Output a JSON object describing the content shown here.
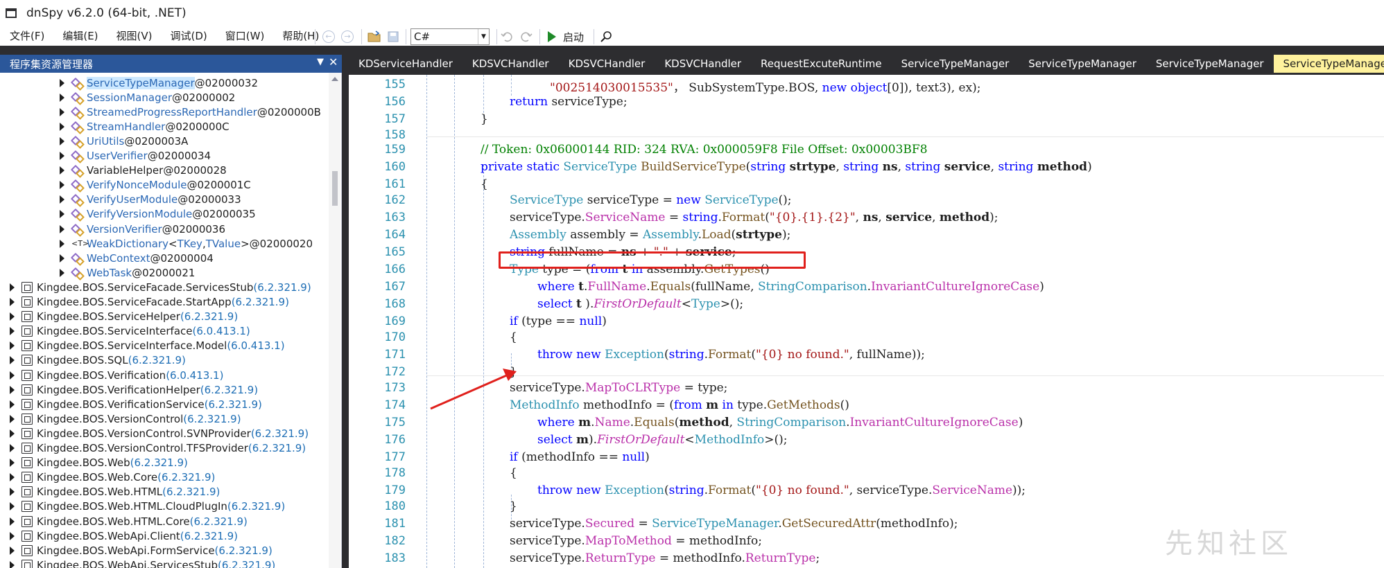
{
  "window": {
    "title": "dnSpy v6.2.0 (64-bit, .NET)"
  },
  "menu": {
    "items": [
      "文件(F)",
      "编辑(E)",
      "视图(V)",
      "调试(D)",
      "窗口(W)",
      "帮助(H)"
    ]
  },
  "toolbar": {
    "language": "C#",
    "run_label": "启动"
  },
  "explorer": {
    "title": "程序集资源管理器",
    "types": [
      {
        "name": "ServiceTypeManager",
        "token": "@02000032",
        "icon": "class-icon",
        "selected": true
      },
      {
        "name": "SessionManager",
        "token": "@02000002",
        "icon": "class-icon"
      },
      {
        "name": "StreamedProgressReportHandler",
        "token": "@0200000B",
        "icon": "class-icon"
      },
      {
        "name": "StreamHandler",
        "token": "@0200000C",
        "icon": "class-icon"
      },
      {
        "name": "UriUtils",
        "token": "@0200003A",
        "icon": "static-class-icon"
      },
      {
        "name": "UserVerifier",
        "token": "@02000034",
        "icon": "class-icon"
      },
      {
        "name": "VariableHelper",
        "token": "@02000028",
        "icon": "static-class-icon"
      },
      {
        "name": "VerifyNonceModule",
        "token": "@0200001C",
        "icon": "class-icon"
      },
      {
        "name": "VerifyUserModule",
        "token": "@02000033",
        "icon": "class-icon"
      },
      {
        "name": "VerifyVersionModule",
        "token": "@02000035",
        "icon": "class-icon"
      },
      {
        "name": "VersionVerifier",
        "token": "@02000036",
        "icon": "class-icon"
      },
      {
        "name": "WeakDictionary",
        "generic_open": "<",
        "generic_a": "TKey",
        "generic_sep": ", ",
        "generic_b": "TValue",
        "generic_close": ">",
        "token": "@02000020",
        "icon": "generic-class-icon"
      },
      {
        "name": "WebContext",
        "token": "@02000004",
        "icon": "class-icon"
      },
      {
        "name": "WebTask",
        "token": "@02000021",
        "icon": "class-icon"
      }
    ],
    "assemblies": [
      {
        "name": "Kingdee.BOS.ServiceFacade.ServicesStub",
        "version": "(6.2.321.9)"
      },
      {
        "name": "Kingdee.BOS.ServiceFacade.StartApp",
        "version": "(6.2.321.9)"
      },
      {
        "name": "Kingdee.BOS.ServiceHelper",
        "version": "(6.2.321.9)"
      },
      {
        "name": "Kingdee.BOS.ServiceInterface",
        "version": "(6.0.413.1)"
      },
      {
        "name": "Kingdee.BOS.ServiceInterface.Model",
        "version": "(6.0.413.1)"
      },
      {
        "name": "Kingdee.BOS.SQL",
        "version": "(6.2.321.9)"
      },
      {
        "name": "Kingdee.BOS.Verification",
        "version": "(6.0.413.1)"
      },
      {
        "name": "Kingdee.BOS.VerificationHelper",
        "version": "(6.2.321.9)"
      },
      {
        "name": "Kingdee.BOS.VerificationService",
        "version": "(6.2.321.9)"
      },
      {
        "name": "Kingdee.BOS.VersionControl",
        "version": "(6.2.321.9)"
      },
      {
        "name": "Kingdee.BOS.VersionControl.SVNProvider",
        "version": "(6.2.321.9)"
      },
      {
        "name": "Kingdee.BOS.VersionControl.TFSProvider",
        "version": "(6.2.321.9)"
      },
      {
        "name": "Kingdee.BOS.Web",
        "version": "(6.2.321.9)"
      },
      {
        "name": "Kingdee.BOS.Web.Core",
        "version": "(6.2.321.9)"
      },
      {
        "name": "Kingdee.BOS.Web.HTML",
        "version": "(6.2.321.9)"
      },
      {
        "name": "Kingdee.BOS.Web.HTML.CloudPlugIn",
        "version": "(6.2.321.9)"
      },
      {
        "name": "Kingdee.BOS.Web.HTML.Core",
        "version": "(6.2.321.9)"
      },
      {
        "name": "Kingdee.BOS.WebApi.Client",
        "version": "(6.2.321.9)"
      },
      {
        "name": "Kingdee.BOS.WebApi.FormService",
        "version": "(6.2.321.9)"
      },
      {
        "name": "Kingdee.BOS.WebApi.ServicesStub",
        "version": "(6.2.321.9)"
      }
    ]
  },
  "tabs": [
    {
      "label": "KDServiceHandler"
    },
    {
      "label": "KDSVCHandler"
    },
    {
      "label": "KDSVCHandler"
    },
    {
      "label": "KDSVCHandler"
    },
    {
      "label": "RequestExcuteRuntime"
    },
    {
      "label": "ServiceTypeManager"
    },
    {
      "label": "ServiceTypeManager"
    },
    {
      "label": "ServiceTypeManager"
    },
    {
      "label": "ServiceTypeManager",
      "active": true
    }
  ],
  "editor": {
    "lines": [
      {
        "n": "155",
        "tokens": [
          [
            "str",
            "\"002514030015535\""
          ],
          [
            "",
            "， SubSystemType.BOS, "
          ],
          [
            "kw",
            "new"
          ],
          [
            "",
            " "
          ],
          [
            "kw",
            "object"
          ],
          [
            "",
            "[0]), text3), ex);"
          ]
        ]
      },
      {
        "n": "156",
        "tokens": [
          [
            "kw",
            "return"
          ],
          [
            "",
            " serviceType;"
          ]
        ]
      },
      {
        "n": "157",
        "tokens": [
          [
            "",
            "}"
          ]
        ]
      },
      {
        "n": "158",
        "tokens": []
      },
      {
        "n": "159",
        "tokens": [
          [
            "cm",
            "// Token: 0x06000144 RID: 324 RVA: 0x000059F8 File Offset: 0x00003BF8"
          ]
        ]
      },
      {
        "n": "160",
        "tokens": [
          [
            "kw",
            "private static "
          ],
          [
            "ty",
            "ServiceType"
          ],
          [
            "",
            " "
          ],
          [
            "meth",
            "BuildServiceType"
          ],
          [
            "",
            "("
          ],
          [
            "kw",
            "string"
          ],
          [
            "",
            " "
          ],
          [
            "bold",
            "strtype"
          ],
          [
            "",
            ", "
          ],
          [
            "kw",
            "string"
          ],
          [
            "",
            " "
          ],
          [
            "bold",
            "ns"
          ],
          [
            "",
            ", "
          ],
          [
            "kw",
            "string"
          ],
          [
            "",
            " "
          ],
          [
            "bold",
            "service"
          ],
          [
            "",
            ", "
          ],
          [
            "kw",
            "string"
          ],
          [
            "",
            " "
          ],
          [
            "bold",
            "method"
          ],
          [
            "",
            ")"
          ]
        ]
      },
      {
        "n": "161",
        "tokens": [
          [
            "",
            "{"
          ]
        ]
      },
      {
        "n": "162",
        "tokens": [
          [
            "ty",
            "ServiceType"
          ],
          [
            "",
            " serviceType = "
          ],
          [
            "kw",
            "new"
          ],
          [
            "",
            " "
          ],
          [
            "ty",
            "ServiceType"
          ],
          [
            "",
            "();"
          ]
        ]
      },
      {
        "n": "163",
        "tokens": [
          [
            "",
            "serviceType."
          ],
          [
            "mem",
            "ServiceName"
          ],
          [
            "",
            " = "
          ],
          [
            "kw",
            "string"
          ],
          [
            "",
            "."
          ],
          [
            "meth",
            "Format"
          ],
          [
            "",
            "("
          ],
          [
            "str",
            "\"{0}.{1}.{2}\""
          ],
          [
            "",
            ", "
          ],
          [
            "bold",
            "ns"
          ],
          [
            "",
            ", "
          ],
          [
            "bold",
            "service"
          ],
          [
            "",
            ", "
          ],
          [
            "bold",
            "method"
          ],
          [
            "",
            ");"
          ]
        ]
      },
      {
        "n": "164",
        "tokens": [
          [
            "ty",
            "Assembly"
          ],
          [
            "",
            " assembly = "
          ],
          [
            "ty",
            "Assembly"
          ],
          [
            "",
            "."
          ],
          [
            "meth",
            "Load"
          ],
          [
            "",
            "("
          ],
          [
            "bold",
            "strtype"
          ],
          [
            "",
            ");"
          ]
        ]
      },
      {
        "n": "165",
        "tokens": [
          [
            "kw",
            "string"
          ],
          [
            "",
            " fullName = "
          ],
          [
            "bold",
            "ns"
          ],
          [
            "",
            " + "
          ],
          [
            "str",
            "\".\""
          ],
          [
            "",
            " + "
          ],
          [
            "bold",
            "service"
          ],
          [
            "",
            ";"
          ]
        ]
      },
      {
        "n": "166",
        "tokens": [
          [
            "ty",
            "Type"
          ],
          [
            "",
            " type = ("
          ],
          [
            "kw",
            "from"
          ],
          [
            "",
            " "
          ],
          [
            "bold",
            "t"
          ],
          [
            "",
            " "
          ],
          [
            "kw",
            "in"
          ],
          [
            "",
            " assembly."
          ],
          [
            "meth",
            "GetTypes"
          ],
          [
            "",
            "()"
          ]
        ]
      },
      {
        "n": "167",
        "tokens": [
          [
            "kw",
            "where"
          ],
          [
            "",
            " "
          ],
          [
            "bold",
            "t"
          ],
          [
            "",
            "."
          ],
          [
            "mem",
            "FullName"
          ],
          [
            "",
            "."
          ],
          [
            "meth",
            "Equals"
          ],
          [
            "",
            "(fullName, "
          ],
          [
            "ty",
            "StringComparison"
          ],
          [
            "",
            "."
          ],
          [
            "mem",
            "InvariantCultureIgnoreCase"
          ],
          [
            "",
            ")"
          ]
        ]
      },
      {
        "n": "168",
        "tokens": [
          [
            "kw",
            "select"
          ],
          [
            "",
            " "
          ],
          [
            "bold",
            "t"
          ],
          [
            "",
            " )."
          ],
          [
            "it",
            "FirstOrDefault"
          ],
          [
            "",
            "<"
          ],
          [
            "ty",
            "Type"
          ],
          [
            "",
            ">();"
          ]
        ]
      },
      {
        "n": "169",
        "tokens": [
          [
            "kw",
            "if"
          ],
          [
            "",
            " (type == "
          ],
          [
            "kw",
            "null"
          ],
          [
            "",
            ")"
          ]
        ]
      },
      {
        "n": "170",
        "tokens": [
          [
            "",
            "{"
          ]
        ]
      },
      {
        "n": "171",
        "tokens": [
          [
            "kw",
            "throw new "
          ],
          [
            "ty",
            "Exception"
          ],
          [
            "",
            "("
          ],
          [
            "kw",
            "string"
          ],
          [
            "",
            "."
          ],
          [
            "meth",
            "Format"
          ],
          [
            "",
            "("
          ],
          [
            "str",
            "\"{0} no found.\""
          ],
          [
            "",
            ", fullName));"
          ]
        ]
      },
      {
        "n": "172",
        "tokens": [
          [
            "",
            "}"
          ]
        ]
      },
      {
        "n": "173",
        "tokens": [
          [
            "",
            "serviceType."
          ],
          [
            "mem",
            "MapToCLRType"
          ],
          [
            "",
            " = type;"
          ]
        ]
      },
      {
        "n": "174",
        "tokens": [
          [
            "ty",
            "MethodInfo"
          ],
          [
            "",
            " methodInfo = ("
          ],
          [
            "kw",
            "from"
          ],
          [
            "",
            " "
          ],
          [
            "bold",
            "m"
          ],
          [
            "",
            " "
          ],
          [
            "kw",
            "in"
          ],
          [
            "",
            " type."
          ],
          [
            "meth",
            "GetMethods"
          ],
          [
            "",
            "()"
          ]
        ]
      },
      {
        "n": "175",
        "tokens": [
          [
            "kw",
            "where"
          ],
          [
            "",
            " "
          ],
          [
            "bold",
            "m"
          ],
          [
            "",
            "."
          ],
          [
            "mem",
            "Name"
          ],
          [
            "",
            "."
          ],
          [
            "meth",
            "Equals"
          ],
          [
            "",
            "("
          ],
          [
            "bold",
            "method"
          ],
          [
            "",
            ", "
          ],
          [
            "ty",
            "StringComparison"
          ],
          [
            "",
            "."
          ],
          [
            "mem",
            "InvariantCultureIgnoreCase"
          ],
          [
            "",
            ")"
          ]
        ]
      },
      {
        "n": "176",
        "tokens": [
          [
            "kw",
            "select"
          ],
          [
            "",
            " "
          ],
          [
            "bold",
            "m"
          ],
          [
            "",
            ")."
          ],
          [
            "it",
            "FirstOrDefault"
          ],
          [
            "",
            "<"
          ],
          [
            "ty",
            "MethodInfo"
          ],
          [
            "",
            ">();"
          ]
        ]
      },
      {
        "n": "177",
        "tokens": [
          [
            "kw",
            "if"
          ],
          [
            "",
            " (methodInfo == "
          ],
          [
            "kw",
            "null"
          ],
          [
            "",
            ")"
          ]
        ]
      },
      {
        "n": "178",
        "tokens": [
          [
            "",
            "{"
          ]
        ]
      },
      {
        "n": "179",
        "tokens": [
          [
            "kw",
            "throw new "
          ],
          [
            "ty",
            "Exception"
          ],
          [
            "",
            "("
          ],
          [
            "kw",
            "string"
          ],
          [
            "",
            "."
          ],
          [
            "meth",
            "Format"
          ],
          [
            "",
            "("
          ],
          [
            "str",
            "\"{0} no found.\""
          ],
          [
            "",
            ", serviceType."
          ],
          [
            "mem",
            "ServiceName"
          ],
          [
            "",
            "));"
          ]
        ]
      },
      {
        "n": "180",
        "tokens": [
          [
            "",
            "}"
          ]
        ]
      },
      {
        "n": "181",
        "tokens": [
          [
            "",
            "serviceType."
          ],
          [
            "mem",
            "Secured"
          ],
          [
            "",
            " = "
          ],
          [
            "ty",
            "ServiceTypeManager"
          ],
          [
            "",
            "."
          ],
          [
            "meth",
            "GetSecuredAttr"
          ],
          [
            "",
            "(methodInfo);"
          ]
        ]
      },
      {
        "n": "182",
        "tokens": [
          [
            "",
            "serviceType."
          ],
          [
            "mem",
            "MapToMethod"
          ],
          [
            "",
            " = methodInfo;"
          ]
        ]
      },
      {
        "n": "183",
        "tokens": [
          [
            "",
            "serviceType."
          ],
          [
            "mem",
            "ReturnType"
          ],
          [
            "",
            " = methodInfo."
          ],
          [
            "mem",
            "ReturnType"
          ],
          [
            "",
            ";"
          ]
        ]
      }
    ]
  },
  "watermark": "先知社区"
}
